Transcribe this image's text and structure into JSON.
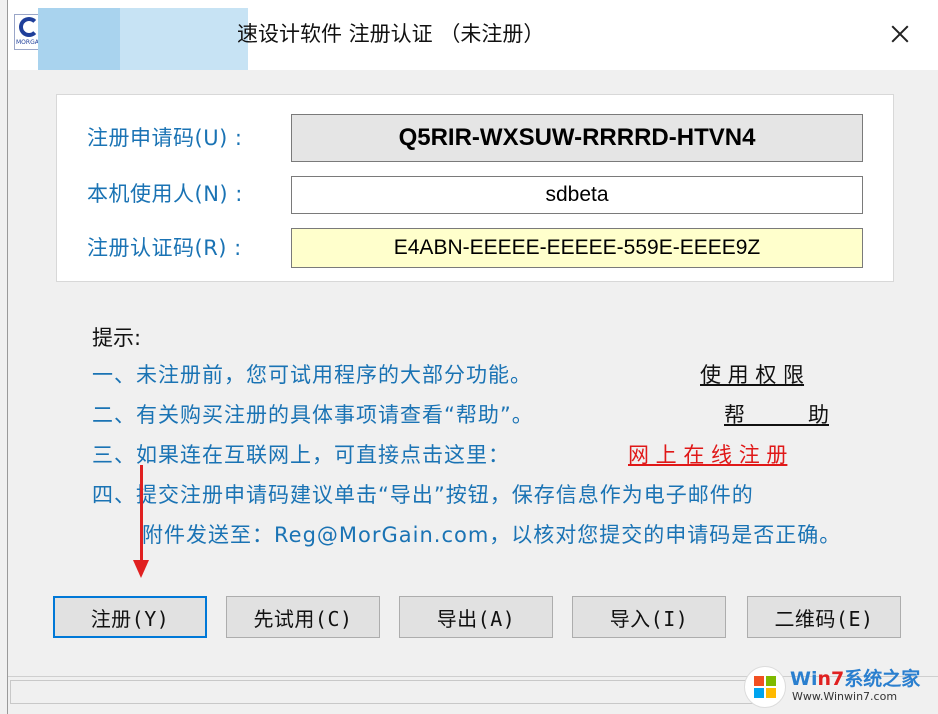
{
  "window": {
    "title": "速设计软件 注册认证 （未注册）",
    "app_icon_text": "MORGAIN"
  },
  "fields": [
    {
      "label": "注册申请码(U) :",
      "value": "Q5RIR-WXSUW-RRRRD-HTVN4"
    },
    {
      "label": "本机使用人(N) :",
      "value": "sdbeta"
    },
    {
      "label": "注册认证码(R) :",
      "value": "E4ABN-EEEEE-EEEEE-559E-EEEE9Z"
    }
  ],
  "tips": {
    "title": "提示:",
    "lines": [
      "一、未注册前，您可试用程序的大部分功能。",
      "二、有关购买注册的具体事项请查看“帮助”。",
      "三、如果连在互联网上，可直接点击这里：",
      "四、提交注册申请码建议单击“导出”按钮，保存信息作为电子邮件的",
      "附件发送至：Reg@MorGain.com，以核对您提交的申请码是否正确。"
    ],
    "links": {
      "usage_limits": "使 用 权 限",
      "help": "帮　　　助",
      "register_online": "网 上 在 线 注 册"
    }
  },
  "buttons": {
    "register": "注册(Y)",
    "trial": "先试用(C)",
    "export": "导出(A)",
    "import": "导入(I)",
    "qrcode": "二维码(E)"
  },
  "watermark": {
    "title_prefix": "Wi",
    "title_accent": "n7",
    "title_suffix": "系统之家",
    "url": "Www.Winwin7.com"
  },
  "colors": {
    "label_blue": "#1a73b4",
    "link_red": "#e01818",
    "arrow_red": "#e02020",
    "auth_field_bg": "#ffffcc",
    "default_button_border": "#0078d7"
  }
}
